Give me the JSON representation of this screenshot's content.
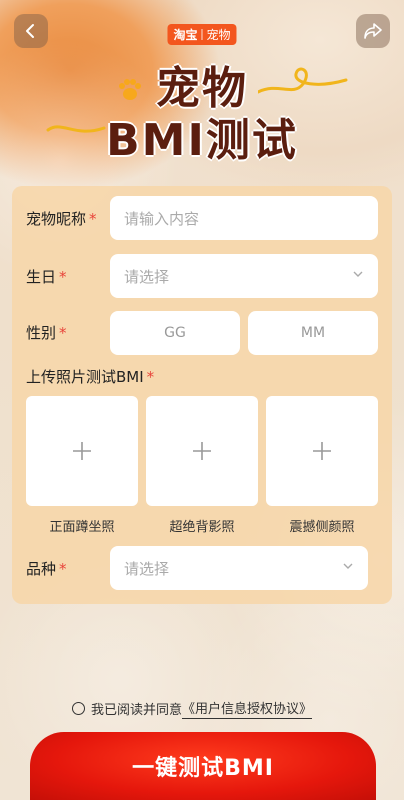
{
  "header": {
    "brand_main": "淘宝",
    "brand_sub": "宠物",
    "title_line1": "宠物",
    "title_line2": "BMI测试"
  },
  "form": {
    "nickname": {
      "label": "宠物昵称",
      "placeholder": "请输入内容"
    },
    "birthday": {
      "label": "生日",
      "placeholder": "请选择"
    },
    "gender": {
      "label": "性别",
      "options": [
        "GG",
        "MM"
      ]
    },
    "upload": {
      "label": "上传照片测试BMI",
      "slots": [
        "正面蹲坐照",
        "超绝背影照",
        "震撼侧颜照"
      ]
    },
    "breed": {
      "label": "品种",
      "placeholder": "请选择"
    },
    "required_mark": "*"
  },
  "agreement": {
    "prefix": "我已阅读并同意",
    "link": "《用户信息授权协议》"
  },
  "cta": {
    "label": "一键测试BMI"
  },
  "colors": {
    "accent": "#e5170c",
    "brand": "#f3561e",
    "panel": "#f7d6a8",
    "title": "#5b1e0f"
  },
  "icons": [
    "back-arrow-icon",
    "share-icon",
    "paw-icon",
    "chevron-down-icon",
    "plus-icon"
  ]
}
